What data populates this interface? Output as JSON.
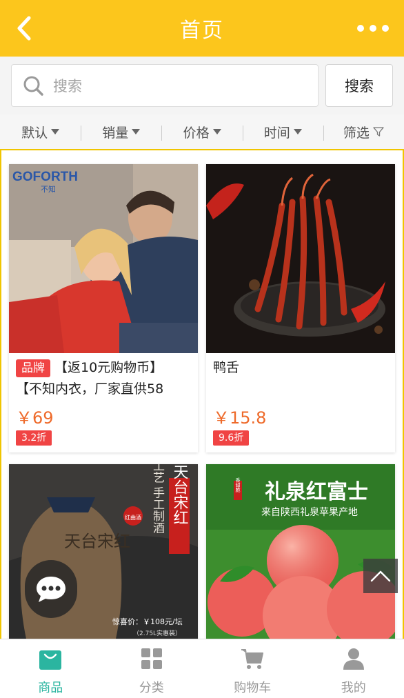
{
  "header": {
    "title": "首页"
  },
  "search": {
    "placeholder": "搜索",
    "button_label": "搜索"
  },
  "sort_bar": {
    "items": [
      "默认",
      "销量",
      "价格",
      "时间",
      "筛选"
    ]
  },
  "products": [
    {
      "brand_tag": "品牌",
      "title_line1": "【返10元购物币】",
      "title_line2": "【不知内衣，厂家直供58",
      "price": "￥69",
      "discount": "3.2折",
      "image_text": "GOFORTH",
      "image_subtext": "不知"
    },
    {
      "title_line1": "鸭舌",
      "price": "￥15.8",
      "discount": "9.6折"
    },
    {
      "image_text_main": "天台宋红",
      "image_text_vertical": "宋红工艺 手工制酒",
      "image_badge": "红曲酒",
      "image_price": "惊喜价：￥108元/坛",
      "image_note": "（2.75L实惠装）"
    },
    {
      "image_badge": "香甜脆",
      "image_title": "礼泉红富士",
      "image_subtitle": "来自陕西礼泉苹果产地"
    }
  ],
  "tabbar": {
    "items": [
      {
        "label": "商品",
        "icon": "bag-icon",
        "active": true
      },
      {
        "label": "分类",
        "icon": "grid-icon",
        "active": false
      },
      {
        "label": "购物车",
        "icon": "cart-icon",
        "active": false
      },
      {
        "label": "我的",
        "icon": "user-icon",
        "active": false
      }
    ]
  },
  "colors": {
    "header": "#fcc61c",
    "accent": "#2bb5a0",
    "price": "#ee6a2a",
    "tag": "#f04444"
  }
}
